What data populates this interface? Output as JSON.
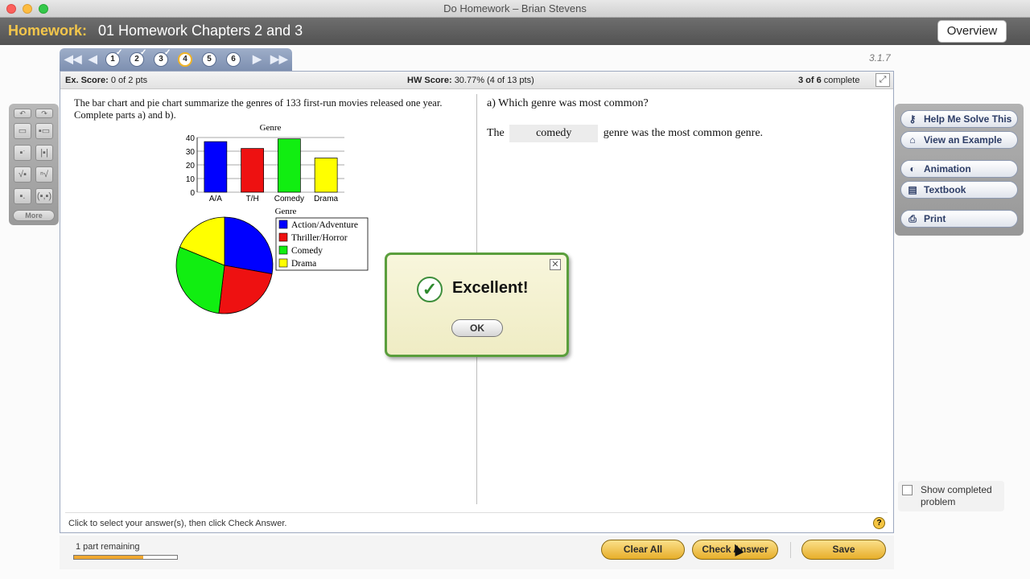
{
  "window": {
    "title": "Do Homework – Brian Stevens"
  },
  "header": {
    "label": "Homework:",
    "title": "01 Homework Chapters 2 and 3",
    "overview_label": "Overview"
  },
  "nav": {
    "questions": [
      {
        "number": "1",
        "completed": true
      },
      {
        "number": "2",
        "completed": true
      },
      {
        "number": "3",
        "completed": true
      },
      {
        "number": "4",
        "completed": false,
        "current": true
      },
      {
        "number": "5",
        "completed": false
      },
      {
        "number": "6",
        "completed": false
      }
    ],
    "version": "3.1.7"
  },
  "scores": {
    "ex_label": "Ex. Score:",
    "ex_value": "0 of 2 pts",
    "hw_label": "HW Score:",
    "hw_value": "30.77% (4 of 13 pts)",
    "progress_bold": "3 of 6",
    "progress_suffix": "complete"
  },
  "question": {
    "text": "The bar chart and pie chart summarize the genres of 133 first-run movies released one year. Complete parts a) and b).",
    "part_a": "a) Which genre was most common?",
    "answer_prefix": "The",
    "answer_value": "comedy",
    "answer_suffix": "genre was the most common genre.",
    "hint": "Click to select your answer(s), then click Check Answer."
  },
  "chart_data": [
    {
      "type": "bar",
      "title": "Genre",
      "categories": [
        "A/A",
        "T/H",
        "Comedy",
        "Drama"
      ],
      "values": [
        37,
        32,
        39,
        25
      ],
      "ylim": [
        0,
        40
      ],
      "yticks": [
        "0",
        "10",
        "20",
        "30",
        "40"
      ],
      "colors": [
        "#0000ff",
        "#ee1111",
        "#11ee11",
        "#ffff00"
      ],
      "grid": true
    },
    {
      "type": "pie",
      "title": "Genre",
      "labels": [
        "Action/Adventure",
        "Thriller/Horror",
        "Comedy",
        "Drama"
      ],
      "values": [
        37,
        32,
        39,
        25
      ],
      "colors": [
        "#0000ff",
        "#ee1111",
        "#11ee11",
        "#ffff00"
      ],
      "legend": "right"
    }
  ],
  "palette": {
    "more_label": "More"
  },
  "tools": [
    {
      "label": "Help Me Solve This",
      "icon": "key-icon"
    },
    {
      "label": "View an Example",
      "icon": "house-icon"
    },
    {
      "label": "Animation",
      "icon": "animation-icon"
    },
    {
      "label": "Textbook",
      "icon": "book-icon"
    },
    {
      "label": "Print",
      "icon": "printer-icon"
    }
  ],
  "show_completed": {
    "label": "Show completed problem",
    "checked": false
  },
  "bottom": {
    "remaining": "1 part remaining",
    "progress_fraction": 0.67,
    "clear_label": "Clear All",
    "check_label": "Check Answer",
    "save_label": "Save"
  },
  "dialog": {
    "message": "Excellent!",
    "ok_label": "OK"
  }
}
